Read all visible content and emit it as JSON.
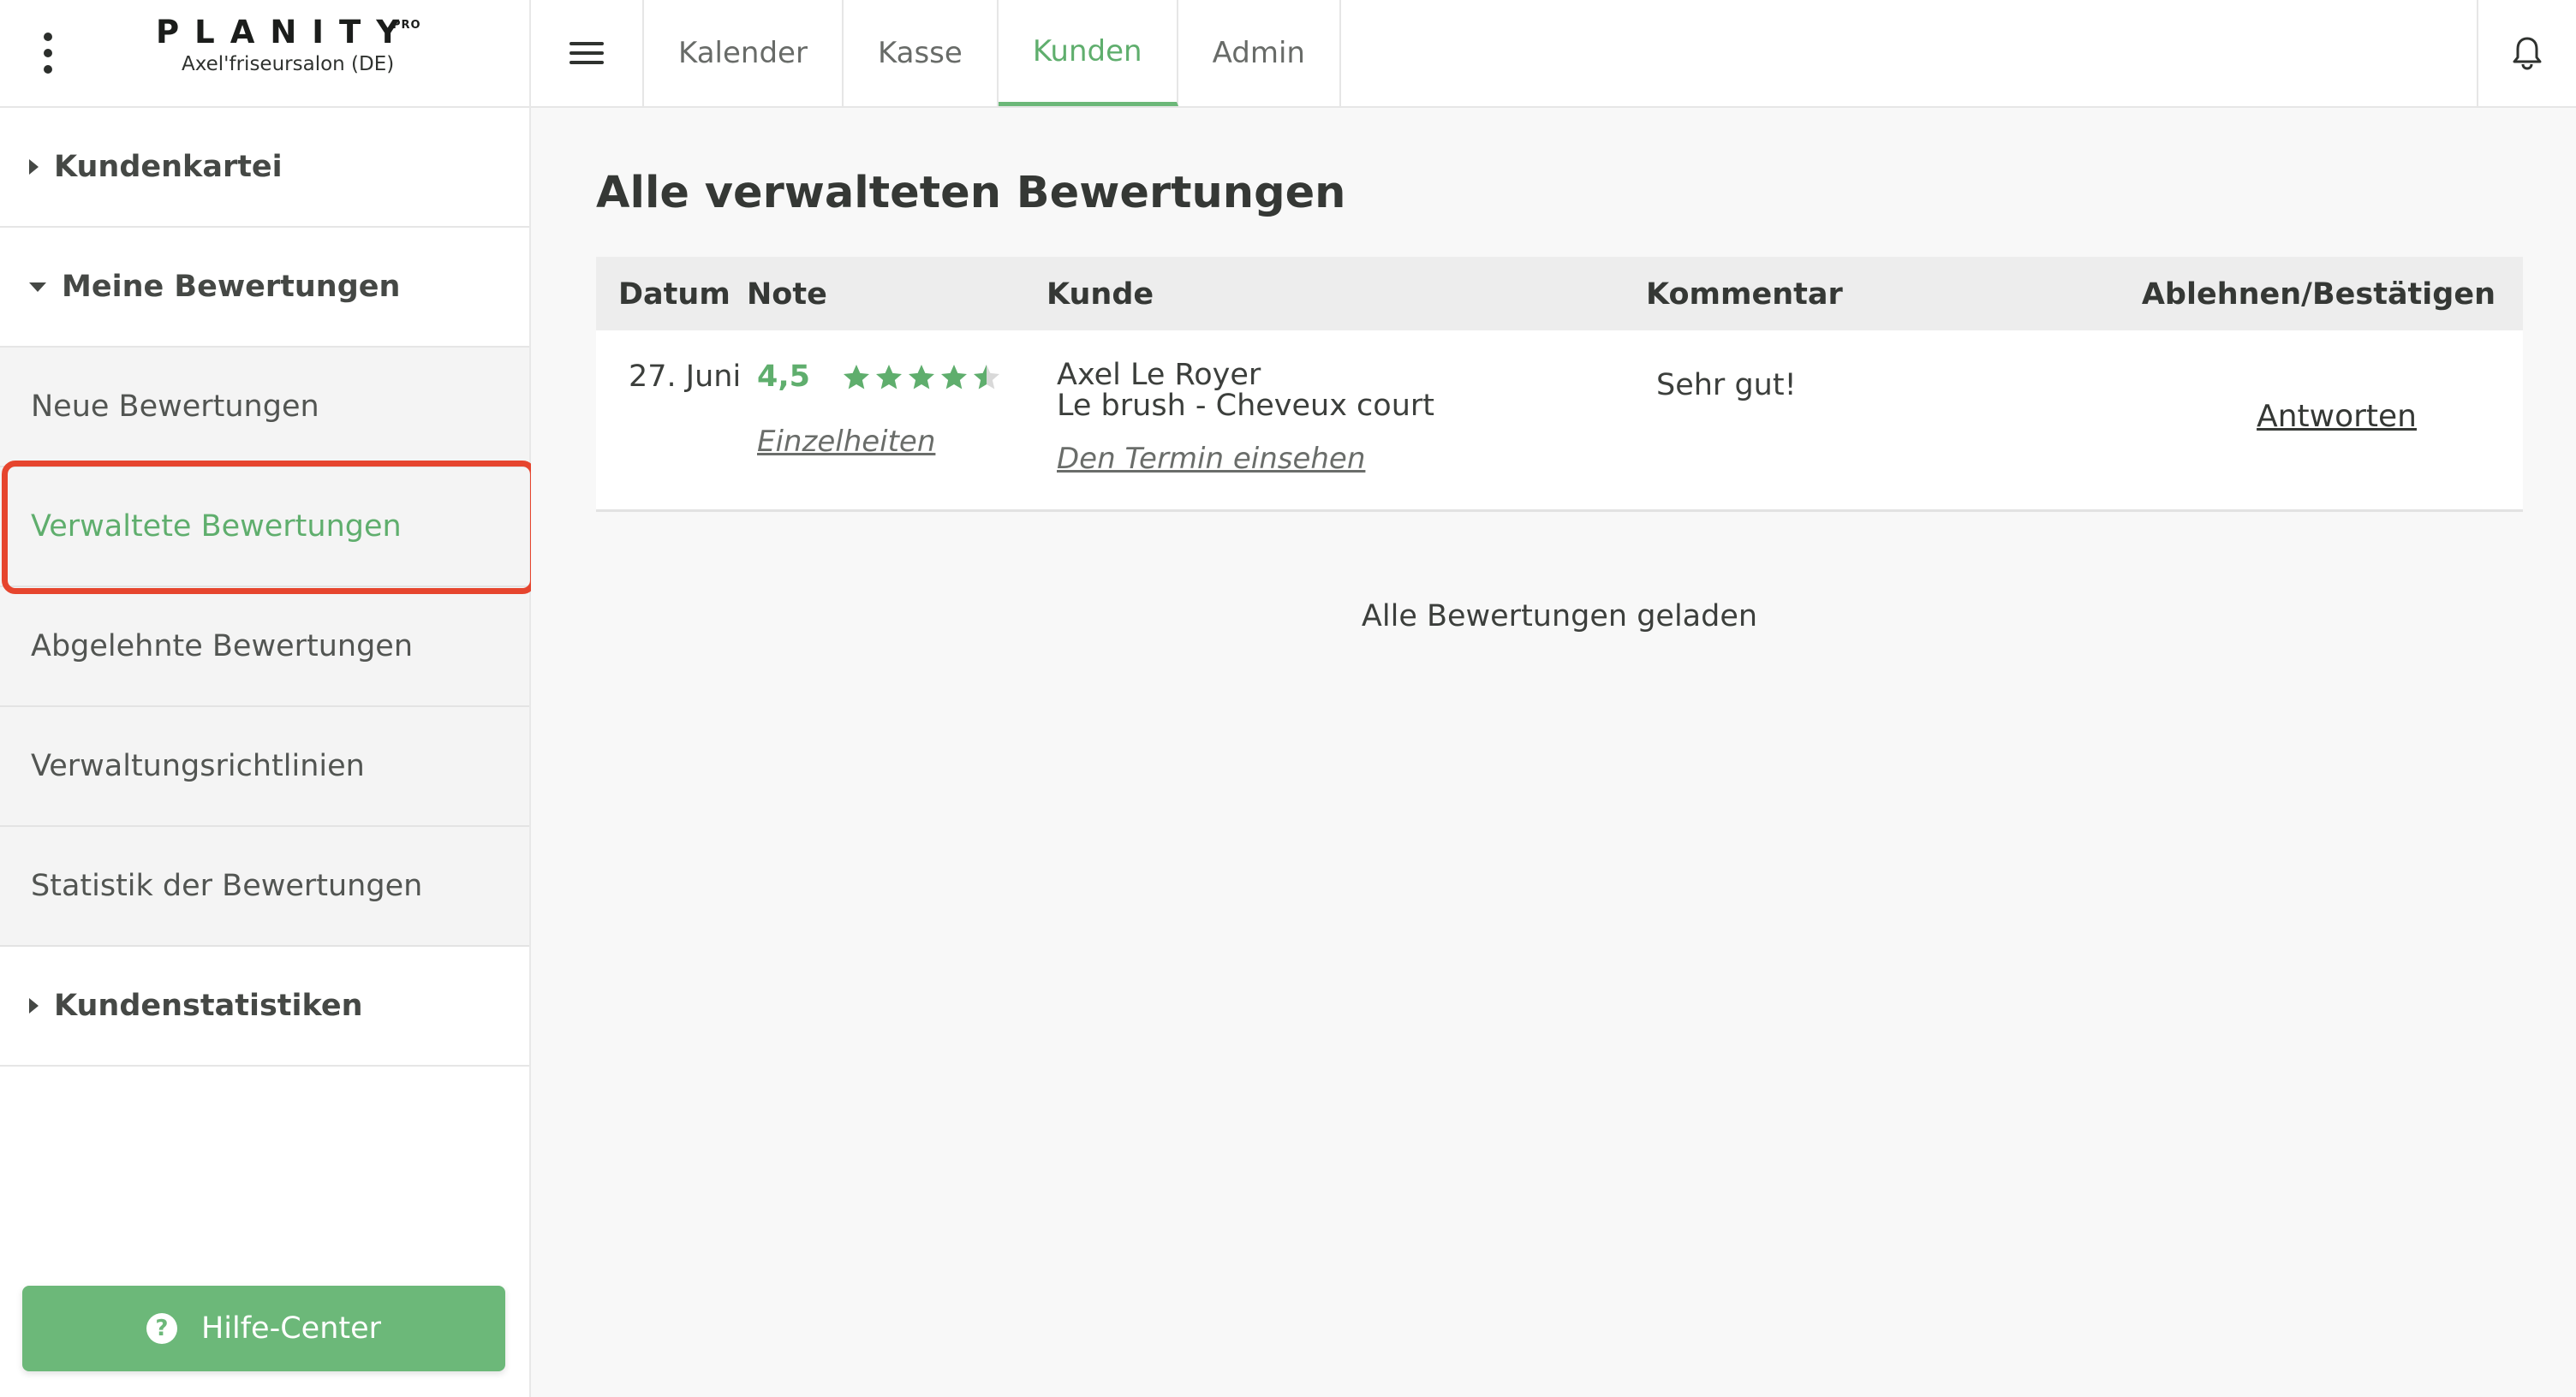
{
  "brand": {
    "logo": "PLANITY",
    "logo_badge": "PRO",
    "salon": "Axel'friseursalon (DE)"
  },
  "sidebar": {
    "section_1": "Kundenkartei",
    "section_2": "Meine Bewertungen",
    "items": [
      "Neue Bewertungen",
      "Verwaltete Bewertungen",
      "Abgelehnte Bewertungen",
      "Verwaltungsrichtlinien",
      "Statistik der Bewertungen"
    ],
    "section_3": "Kundenstatistiken",
    "help_label": "Hilfe-Center"
  },
  "topbar": {
    "tabs": [
      "Kalender",
      "Kasse",
      "Kunden",
      "Admin"
    ],
    "active_tab": "Kunden"
  },
  "main": {
    "title": "Alle verwalteten Bewertungen",
    "columns": {
      "date": "Datum",
      "note": "Note",
      "customer": "Kunde",
      "comment": "Kommentar",
      "action": "Ablehnen/Bestätigen"
    },
    "rows": [
      {
        "date": "27. Juni",
        "rating": "4,5",
        "rating_value": 4.5,
        "details_link": "Einzelheiten",
        "customer_name": "Axel Le Royer",
        "service": "Le brush - Cheveux court",
        "appointment_link": "Den Termin einsehen",
        "comment": "Sehr gut!",
        "action_label": "Antworten"
      }
    ],
    "footer": "Alle Bewertungen geladen"
  },
  "colors": {
    "accent": "#6cb879",
    "highlight": "#e6452e"
  }
}
